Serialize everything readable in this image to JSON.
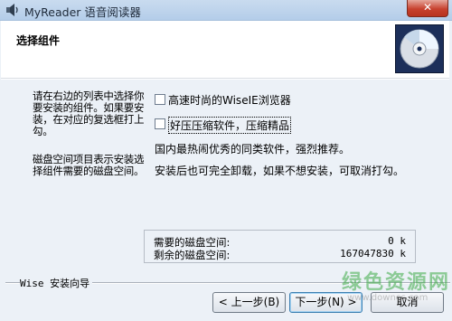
{
  "window": {
    "title": "MyReader 语音阅读器",
    "close_symbol": "✕",
    "app_icon": "speaker-app-icon"
  },
  "header": {
    "title": "选择组件",
    "icon": "cd-disc-icon"
  },
  "instructions": {
    "paragraph1": "请在右边的列表中选择你要安装的组件。如果要安装，在对应的复选框打上勾。",
    "paragraph2": "磁盘空间项目表示安装选择组件需要的磁盘空间。"
  },
  "components": [
    {
      "label": "高速时尚的WiseIE浏览器",
      "checked": false
    },
    {
      "label": "好压压缩软件，压缩精品",
      "checked": false
    }
  ],
  "info": {
    "line1": "国内最热闹优秀的同类软件，强烈推荐。",
    "line2": "安装后也可完全卸载，如果不想安装，可取消打勾。"
  },
  "disk": {
    "required_label": "需要的磁盘空间:",
    "required_value": "0 k",
    "remaining_label": "剩余的磁盘空间:",
    "remaining_value": "167047830 k"
  },
  "footer": {
    "wizard_label": "Wise 安装向导",
    "back_label": "< 上一步(B)",
    "next_label": "下一步(N) >",
    "cancel_label": "取消"
  },
  "watermark": {
    "text": "绿色资源网",
    "url": "www.downcc.com"
  },
  "colors": {
    "window_bg": "#ecf1f7",
    "close_button": "#c7412e",
    "watermark": "#3caa46"
  }
}
